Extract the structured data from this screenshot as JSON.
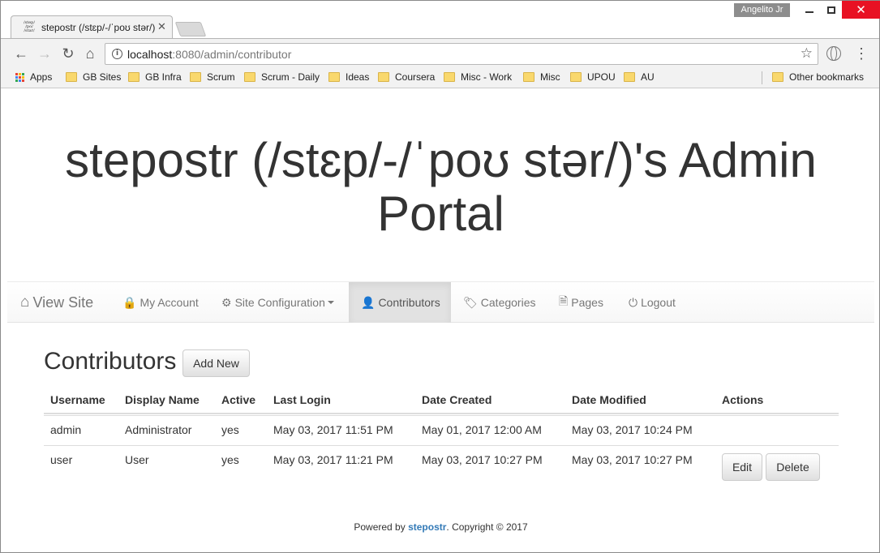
{
  "browser": {
    "profile_name": "Angelito Jr",
    "tab_title": "stepostr (/stɛp/-/ˈpoʊ stər/)'s Admin Portal",
    "tab_favicon_text": "/step/ /po/ /star/",
    "url_host": "localhost",
    "url_path": ":8080/admin/contributor",
    "bookmarks": [
      {
        "label": "Apps",
        "icon": "apps-grid-icon"
      },
      {
        "label": "GB Sites",
        "icon": "folder-icon"
      },
      {
        "label": "GB Infra",
        "icon": "folder-icon"
      },
      {
        "label": "Scrum",
        "icon": "folder-icon"
      },
      {
        "label": "Scrum - Daily",
        "icon": "folder-icon"
      },
      {
        "label": "Ideas",
        "icon": "folder-icon"
      },
      {
        "label": "Coursera",
        "icon": "folder-icon"
      },
      {
        "label": "Misc - Work",
        "icon": "folder-icon"
      },
      {
        "label": "Misc",
        "icon": "folder-icon"
      },
      {
        "label": "UPOU",
        "icon": "folder-icon"
      },
      {
        "label": "AU",
        "icon": "folder-icon"
      }
    ],
    "other_bookmarks": "Other bookmarks"
  },
  "page": {
    "hero_title_line1": "stepostr (/stɛp/-/ˈpoʊ stər/)'s Admin",
    "hero_title_line2": "Portal"
  },
  "navbar": {
    "brand": "View Site",
    "items": [
      {
        "label": "My Account",
        "icon": "lock-icon"
      },
      {
        "label": "Site Configuration",
        "icon": "gear-icon"
      },
      {
        "label": "Contributors",
        "icon": "user-icon",
        "active": true
      },
      {
        "label": "Categories",
        "icon": "tags-icon"
      },
      {
        "label": "Pages",
        "icon": "file-icon"
      },
      {
        "label": "Logout",
        "icon": "power-icon"
      }
    ]
  },
  "contributors": {
    "title": "Contributors",
    "add_new_label": "Add New",
    "columns": [
      "Username",
      "Display Name",
      "Active",
      "Last Login",
      "Date Created",
      "Date Modified",
      "Actions"
    ],
    "rows": [
      {
        "username": "admin",
        "display_name": "Administrator",
        "active": "yes",
        "last_login": "May 03, 2017 11:51 PM",
        "date_created": "May 01, 2017 12:00 AM",
        "date_modified": "May 03, 2017 10:24 PM"
      },
      {
        "username": "user",
        "display_name": "User",
        "active": "yes",
        "last_login": "May 03, 2017 11:21 PM",
        "date_created": "May 03, 2017 10:27 PM",
        "date_modified": "May 03, 2017 10:27 PM"
      }
    ],
    "edit_label": "Edit",
    "delete_label": "Delete"
  },
  "footer": {
    "prefix": "Powered by ",
    "link": "stepostr",
    "suffix": ". Copyright © 2017"
  },
  "colors": {
    "link": "#337ab7",
    "close_button": "#e81123",
    "active_nav": "#e2e2e2"
  }
}
